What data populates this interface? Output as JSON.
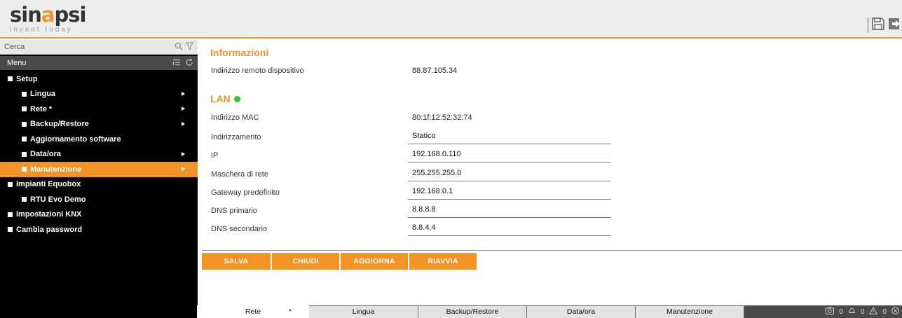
{
  "header": {
    "logo_brand_pre": "sin",
    "logo_brand_hl": "a",
    "logo_brand_post": "psi",
    "logo_tagline": "invent today",
    "save_icon": "floppy-disk-icon",
    "logout_icon": "logout-arrow-icon"
  },
  "sidebar": {
    "search_placeholder": "Cerca",
    "menu_title": "Menu",
    "items": [
      {
        "label": "Setup"
      },
      {
        "label": "Lingua"
      },
      {
        "label": "Rete *"
      },
      {
        "label": "Backup/Restore"
      },
      {
        "label": "Aggiornamento software"
      },
      {
        "label": "Data/ora"
      },
      {
        "label": "Manutenzione"
      },
      {
        "label": "Impianti Equobox"
      },
      {
        "label": "RTU Evo Demo"
      },
      {
        "label": "Impostazioni KNX"
      },
      {
        "label": "Cambia password"
      }
    ]
  },
  "main": {
    "info_title": "Informazioni",
    "remote_address_label": "Indirizzo remoto dispositivo",
    "remote_address_value": "88.87.105.34",
    "lan_title": "LAN",
    "lan_status": "connected",
    "mac_label": "Indirizzo MAC",
    "mac_value": "80:1f:12:52:32:74",
    "addressing_label": "Indirizzamento",
    "addressing_value": "Statico",
    "ip_label": "IP",
    "ip_value": "192.168.0.110",
    "netmask_label": "Maschera di rete",
    "netmask_value": "255.255.255.0",
    "gateway_label": "Gateway predefinito",
    "gateway_value": "192.168.0.1",
    "dns1_label": "DNS primario",
    "dns1_value": "8.8.8.8",
    "dns2_label": "DNS secondario",
    "dns2_value": "8.8.4.4",
    "buttons": {
      "save": "SALVA",
      "close": "CHIUDI",
      "refresh": "AGGIORNA",
      "reboot": "RIAVVIA"
    }
  },
  "tabs": [
    {
      "label": "Rete",
      "marker": "*"
    },
    {
      "label": "Lingua"
    },
    {
      "label": "Backup/Restore"
    },
    {
      "label": "Data/ora"
    },
    {
      "label": "Manutenzione"
    }
  ],
  "status": {
    "counter1": "0",
    "counter2": "0",
    "counter3": "0"
  },
  "colors": {
    "accent": "#f29326",
    "sidebar_bg": "#000000",
    "lan_ok": "#2ec42e"
  }
}
